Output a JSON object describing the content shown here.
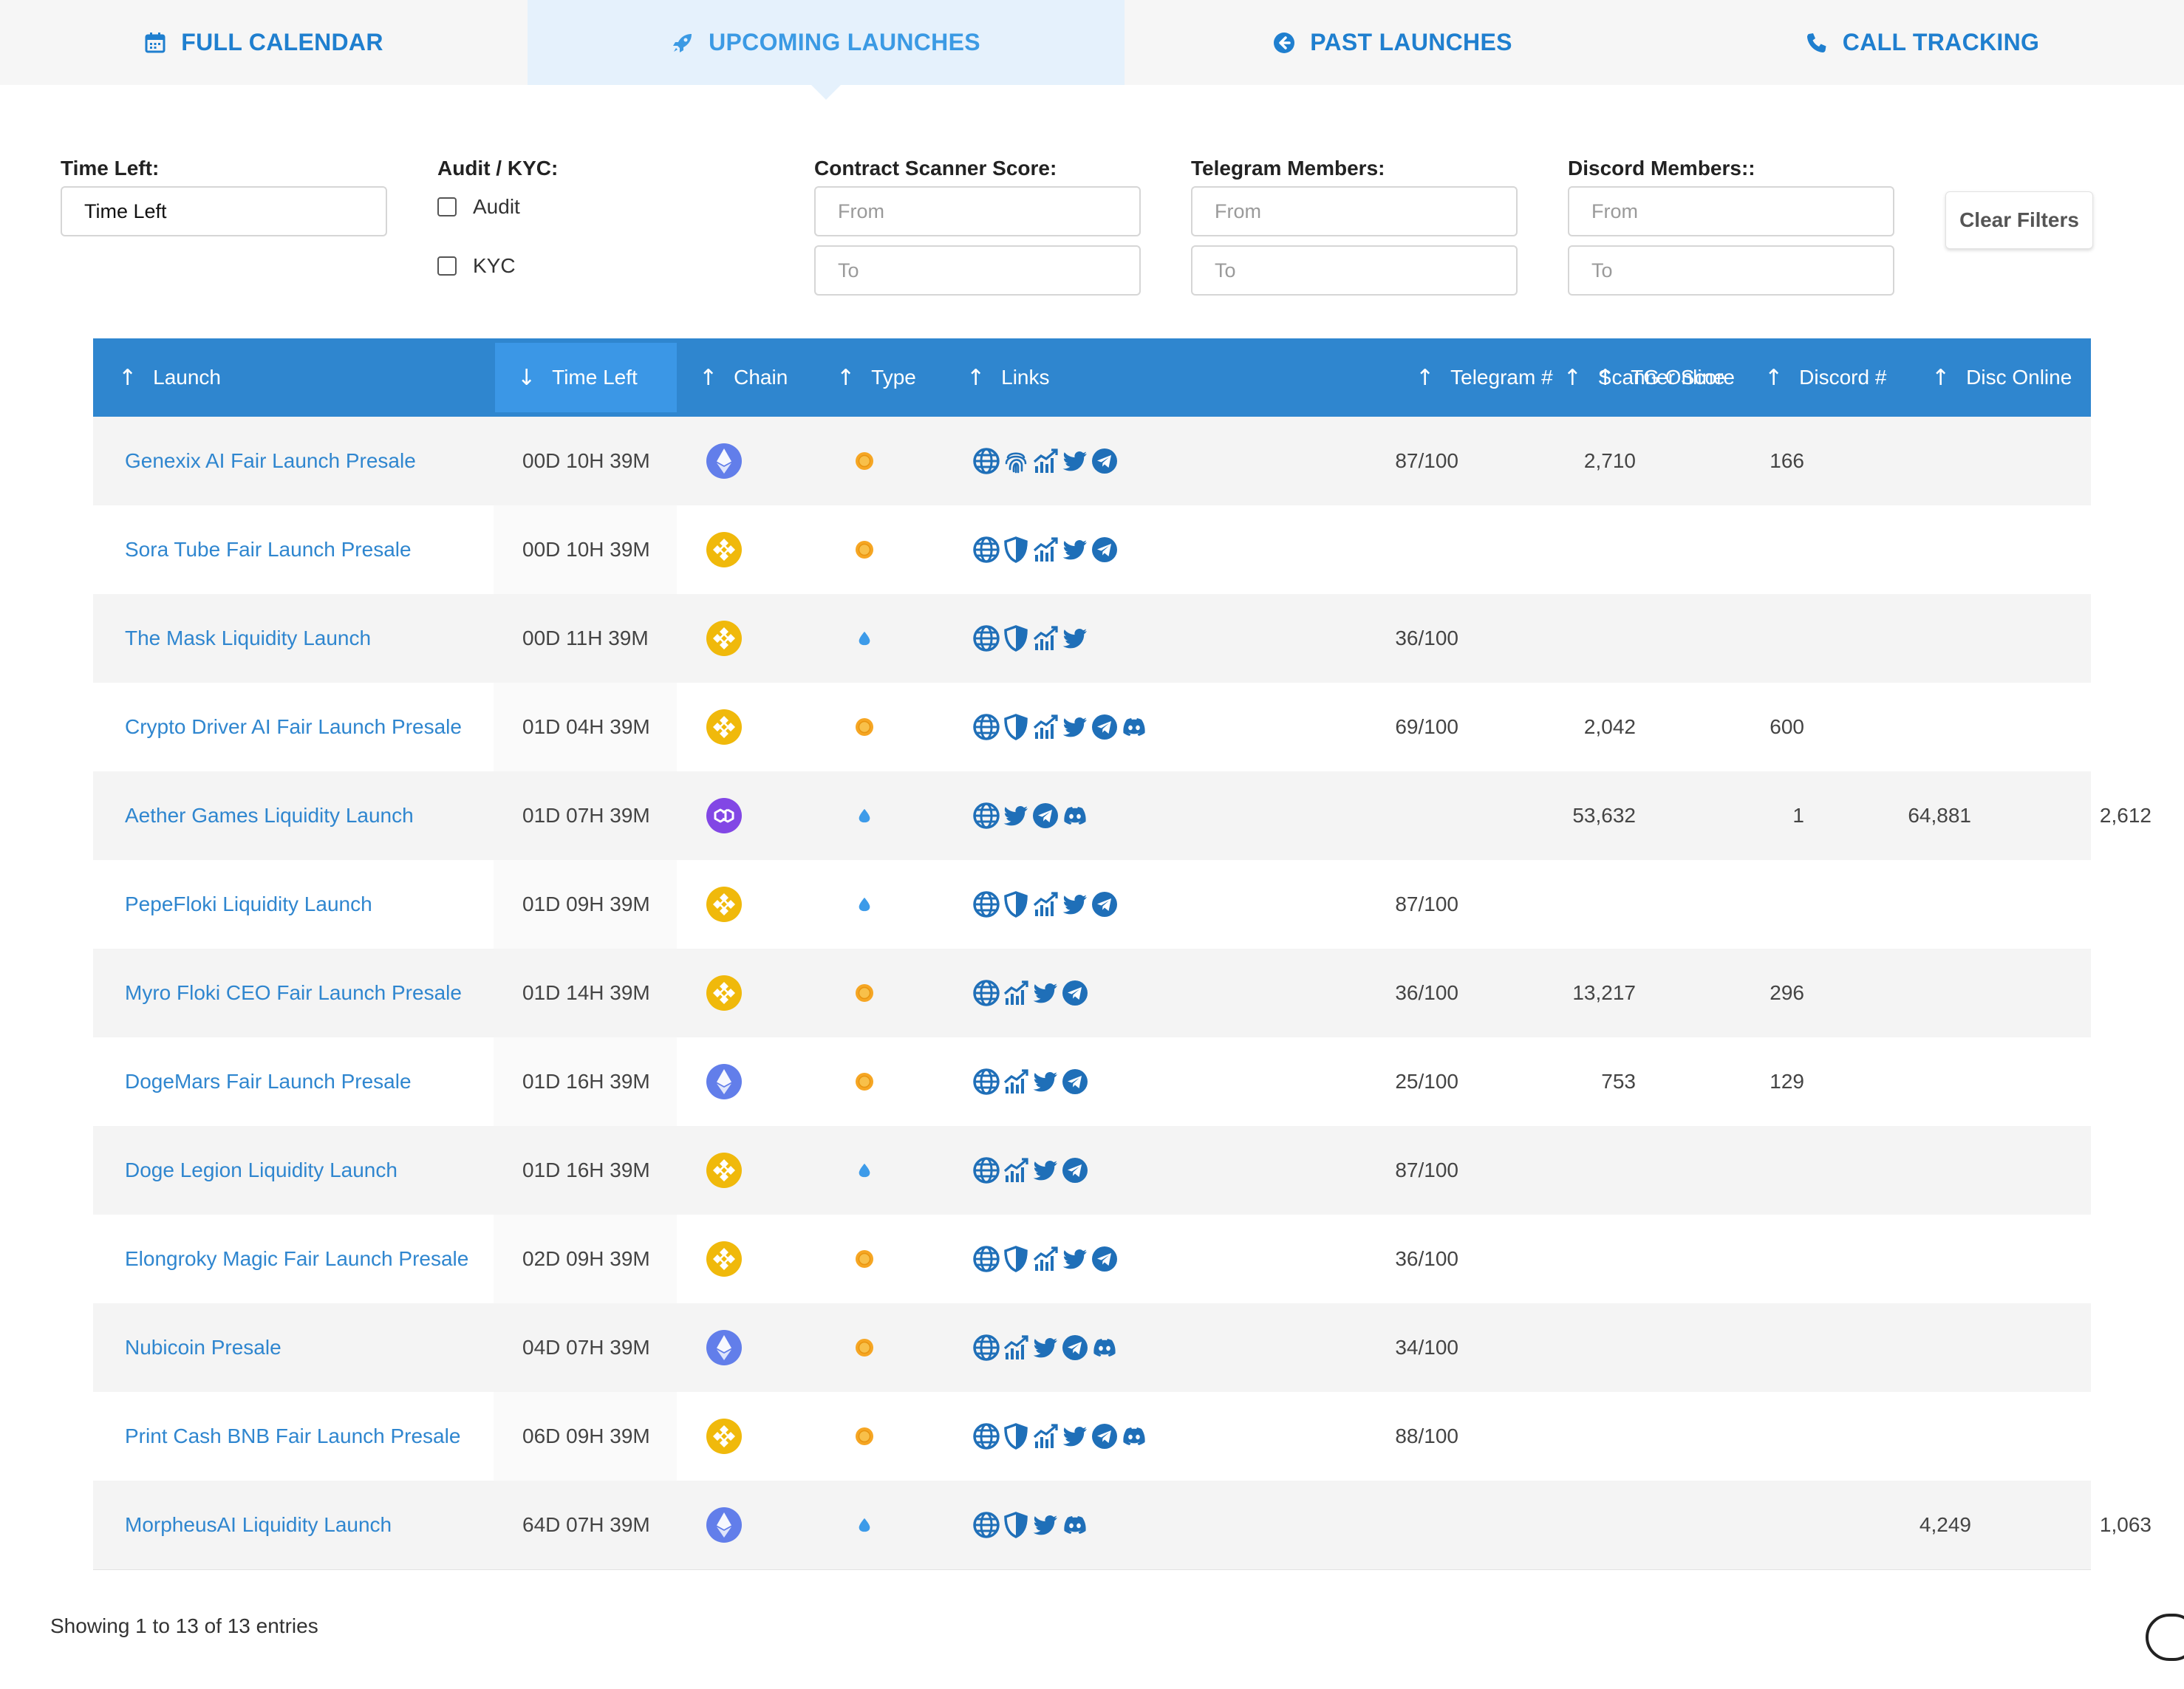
{
  "tabs": [
    {
      "label": "FULL CALENDAR",
      "icon": "calendar-icon"
    },
    {
      "label": "UPCOMING LAUNCHES",
      "icon": "rocket-icon",
      "active": true
    },
    {
      "label": "PAST LAUNCHES",
      "icon": "arrow-circle-left-icon"
    },
    {
      "label": "CALL TRACKING",
      "icon": "phone-icon"
    }
  ],
  "filters": {
    "time_left": {
      "label": "Time Left:",
      "value": "Time Left"
    },
    "audit_kyc": {
      "label": "Audit / KYC:",
      "options": [
        "Audit",
        "KYC"
      ]
    },
    "scanner": {
      "label": "Contract Scanner Score:",
      "from_placeholder": "From",
      "to_placeholder": "To"
    },
    "telegram": {
      "label": "Telegram Members:",
      "from_placeholder": "From",
      "to_placeholder": "To"
    },
    "discord": {
      "label": "Discord Members::",
      "from_placeholder": "From",
      "to_placeholder": "To"
    },
    "clear_label": "Clear Filters"
  },
  "table": {
    "columns": [
      "Launch",
      "Time Left",
      "Chain",
      "Type",
      "Links",
      "Scanner Score",
      "Telegram #",
      "TG Online",
      "Discord #",
      "Disc Online"
    ],
    "sorted_column": "Time Left",
    "rows": [
      {
        "launch": "Genexix AI Fair Launch Presale",
        "time_left": "00D 10H 39M",
        "chain": "ethereum",
        "type": "fair-launch",
        "links": [
          "globe",
          "fingerprint",
          "chart",
          "twitter",
          "telegram"
        ],
        "scanner": "87/100",
        "telegram": "2,710",
        "tg_online": "166",
        "discord": "",
        "disc_online": ""
      },
      {
        "launch": "Sora Tube Fair Launch Presale",
        "time_left": "00D 10H 39M",
        "chain": "bnb",
        "type": "fair-launch",
        "links": [
          "globe",
          "shield",
          "chart",
          "twitter",
          "telegram"
        ],
        "scanner": "",
        "telegram": "",
        "tg_online": "",
        "discord": "",
        "disc_online": ""
      },
      {
        "launch": "The Mask Liquidity Launch",
        "time_left": "00D 11H 39M",
        "chain": "bnb",
        "type": "liquidity",
        "links": [
          "globe",
          "shield",
          "chart",
          "twitter"
        ],
        "scanner": "36/100",
        "telegram": "",
        "tg_online": "",
        "discord": "",
        "disc_online": ""
      },
      {
        "launch": "Crypto Driver AI Fair Launch Presale",
        "time_left": "01D 04H 39M",
        "chain": "bnb",
        "type": "fair-launch",
        "links": [
          "globe",
          "shield",
          "chart",
          "twitter",
          "telegram",
          "discord"
        ],
        "scanner": "69/100",
        "telegram": "2,042",
        "tg_online": "600",
        "discord": "",
        "disc_online": ""
      },
      {
        "launch": "Aether Games Liquidity Launch",
        "time_left": "01D 07H 39M",
        "chain": "polygon",
        "type": "liquidity",
        "links": [
          "globe",
          "twitter",
          "telegram",
          "discord"
        ],
        "scanner": "",
        "telegram": "53,632",
        "tg_online": "1",
        "discord": "64,881",
        "disc_online": "2,612"
      },
      {
        "launch": "PepeFloki Liquidity Launch",
        "time_left": "01D 09H 39M",
        "chain": "bnb",
        "type": "liquidity",
        "links": [
          "globe",
          "shield",
          "chart",
          "twitter",
          "telegram"
        ],
        "scanner": "87/100",
        "telegram": "",
        "tg_online": "",
        "discord": "",
        "disc_online": ""
      },
      {
        "launch": "Myro Floki CEO Fair Launch Presale",
        "time_left": "01D 14H 39M",
        "chain": "bnb",
        "type": "fair-launch",
        "links": [
          "globe",
          "chart",
          "twitter",
          "telegram"
        ],
        "scanner": "36/100",
        "telegram": "13,217",
        "tg_online": "296",
        "discord": "",
        "disc_online": ""
      },
      {
        "launch": "DogeMars Fair Launch Presale",
        "time_left": "01D 16H 39M",
        "chain": "ethereum",
        "type": "fair-launch",
        "links": [
          "globe",
          "chart",
          "twitter",
          "telegram"
        ],
        "scanner": "25/100",
        "telegram": "753",
        "tg_online": "129",
        "discord": "",
        "disc_online": ""
      },
      {
        "launch": "Doge Legion Liquidity Launch",
        "time_left": "01D 16H 39M",
        "chain": "bnb",
        "type": "liquidity",
        "links": [
          "globe",
          "chart",
          "twitter",
          "telegram"
        ],
        "scanner": "87/100",
        "telegram": "",
        "tg_online": "",
        "discord": "",
        "disc_online": ""
      },
      {
        "launch": "Elongroky Magic Fair Launch Presale",
        "time_left": "02D 09H 39M",
        "chain": "bnb",
        "type": "fair-launch",
        "links": [
          "globe",
          "shield",
          "chart",
          "twitter",
          "telegram"
        ],
        "scanner": "36/100",
        "telegram": "",
        "tg_online": "",
        "discord": "",
        "disc_online": ""
      },
      {
        "launch": "Nubicoin Presale",
        "time_left": "04D 07H 39M",
        "chain": "ethereum",
        "type": "fair-launch",
        "links": [
          "globe",
          "chart",
          "twitter",
          "telegram",
          "discord"
        ],
        "scanner": "34/100",
        "telegram": "",
        "tg_online": "",
        "discord": "",
        "disc_online": ""
      },
      {
        "launch": "Print Cash BNB Fair Launch Presale",
        "time_left": "06D 09H 39M",
        "chain": "bnb",
        "type": "fair-launch",
        "links": [
          "globe",
          "shield",
          "chart",
          "twitter",
          "telegram",
          "discord"
        ],
        "scanner": "88/100",
        "telegram": "",
        "tg_online": "",
        "discord": "",
        "disc_online": ""
      },
      {
        "launch": "MorpheusAI Liquidity Launch",
        "time_left": "64D 07H 39M",
        "chain": "ethereum",
        "type": "liquidity",
        "links": [
          "globe",
          "shield",
          "twitter",
          "discord"
        ],
        "scanner": "",
        "telegram": "",
        "tg_online": "",
        "discord": "4,249",
        "disc_online": "1,063"
      }
    ]
  },
  "footer": {
    "info": "Showing 1 to 13 of 13 entries"
  },
  "colors": {
    "primary": "#2f86cf",
    "active_tab": "#3b9ae4",
    "bnb": "#f0b90b",
    "ethereum": "#627eea",
    "polygon": "#8247e5",
    "fair_launch": "#f6a623",
    "liquidity": "#3d9be9"
  }
}
